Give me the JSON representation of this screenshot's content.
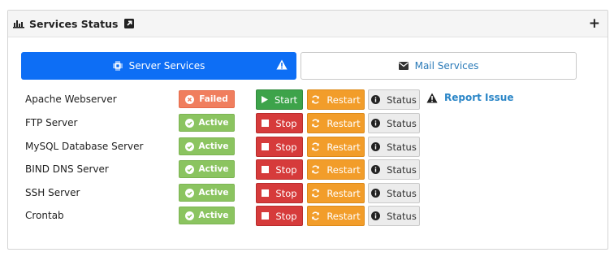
{
  "panel": {
    "title": "Services Status",
    "title_icon": "bar-chart-icon",
    "external_icon": "external-link-icon",
    "add_label": "+"
  },
  "tabs": [
    {
      "label": "Server Services",
      "icon": "chip-icon",
      "active": true,
      "warning_icon": "warning-icon"
    },
    {
      "label": "Mail Services",
      "icon": "envelope-icon",
      "active": false
    }
  ],
  "services": [
    {
      "name": "Apache Webserver",
      "status": "Failed",
      "action": "Start",
      "restart": "Restart",
      "info": "Status",
      "report": "Report Issue"
    },
    {
      "name": "FTP Server",
      "status": "Active",
      "action": "Stop",
      "restart": "Restart",
      "info": "Status"
    },
    {
      "name": "MySQL Database Server",
      "status": "Active",
      "action": "Stop",
      "restart": "Restart",
      "info": "Status"
    },
    {
      "name": "BIND DNS Server",
      "status": "Active",
      "action": "Stop",
      "restart": "Restart",
      "info": "Status"
    },
    {
      "name": "SSH Server",
      "status": "Active",
      "action": "Stop",
      "restart": "Restart",
      "info": "Status"
    },
    {
      "name": "Crontab",
      "status": "Active",
      "action": "Stop",
      "restart": "Restart",
      "info": "Status"
    }
  ],
  "colors": {
    "tab_active": "#0d6ef5",
    "failed": "#f07e5e",
    "active": "#8bc460",
    "start": "#3da34a",
    "stop": "#d63b3b",
    "restart": "#f29d2a",
    "link": "#2b86c7"
  }
}
